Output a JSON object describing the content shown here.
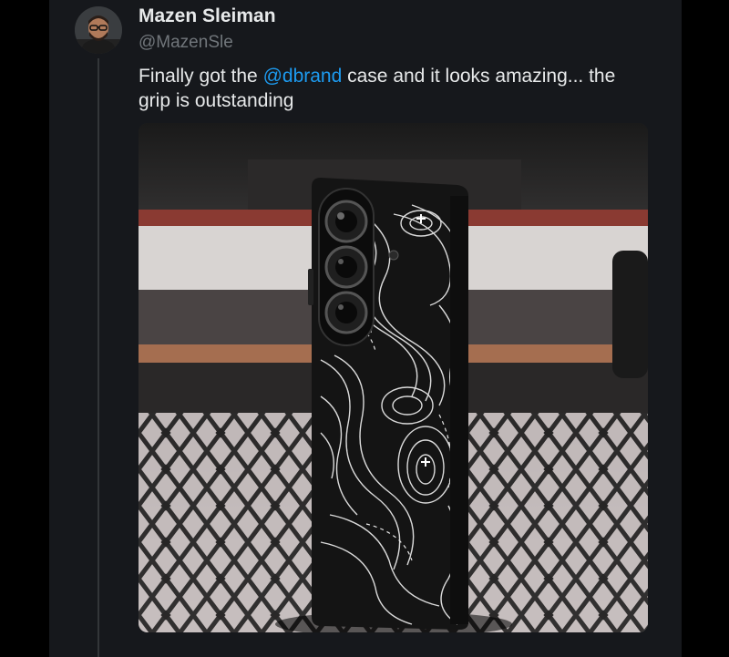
{
  "tweet": {
    "author": {
      "display_name": "Mazen Sleiman",
      "handle": "@MazenSle",
      "avatar_icon": "profile-photo"
    },
    "text_before": "Finally got the ",
    "mention": "@dbrand",
    "text_after": " case and it looks amazing... the grip is outstanding",
    "media": {
      "type": "photo",
      "subject": "black phone case with white topographic line pattern on tiled table"
    }
  },
  "colors": {
    "background": "#000000",
    "panel": "#16181c",
    "text_primary": "#e7e9ea",
    "text_secondary": "#71767b",
    "link": "#1d9bf0",
    "thread_line": "#333639"
  }
}
